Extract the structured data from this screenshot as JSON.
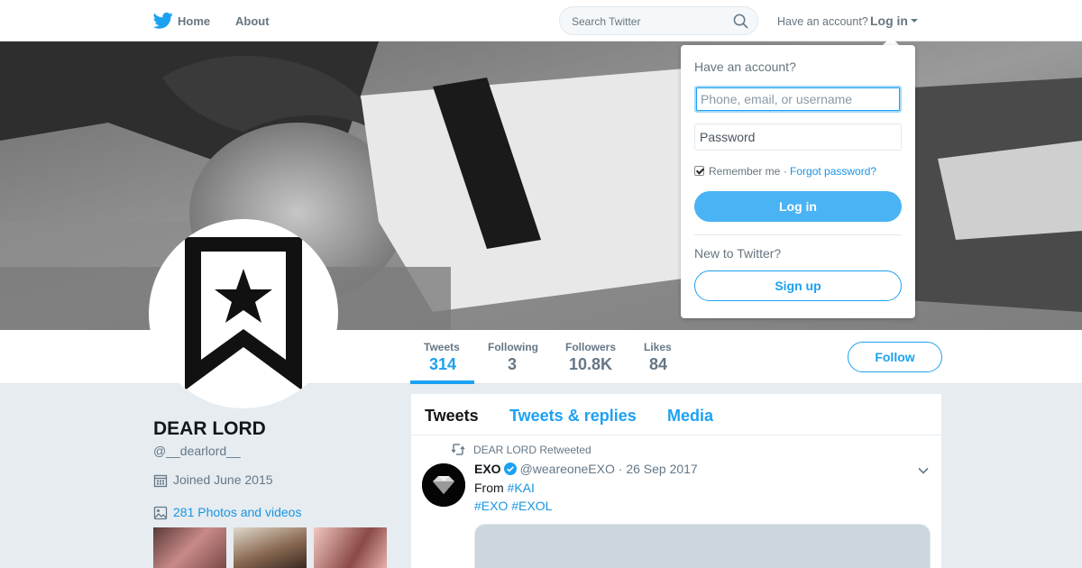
{
  "nav": {
    "home_label": "Home",
    "about_label": "About",
    "search_placeholder": "Search Twitter",
    "have_account": "Have an account?",
    "login_label": "Log in"
  },
  "login_dropdown": {
    "title": "Have an account?",
    "username_placeholder": "Phone, email, or username",
    "password_placeholder": "Password",
    "remember_label": "Remember me",
    "separator": " · ",
    "forgot_label": "Forgot password?",
    "remember_checked": true,
    "login_button": "Log in",
    "new_to_twitter": "New to Twitter?",
    "signup_button": "Sign up"
  },
  "profile_nav": {
    "stats": [
      {
        "label": "Tweets",
        "value": "314",
        "active": true
      },
      {
        "label": "Following",
        "value": "3"
      },
      {
        "label": "Followers",
        "value": "10.8K"
      },
      {
        "label": "Likes",
        "value": "84"
      }
    ],
    "follow_button": "Follow"
  },
  "profile": {
    "name": "DEAR LORD",
    "handle": "@__dearlord__",
    "joined": "Joined June 2015",
    "photos_link": "281 Photos and videos"
  },
  "timeline": {
    "tabs": [
      "Tweets",
      "Tweets & replies",
      "Media"
    ],
    "tweet": {
      "retweet_context": "DEAR LORD Retweeted",
      "author_name": "EXO",
      "author_handle": "@weareoneEXO",
      "separator": " · ",
      "date": "26 Sep 2017",
      "text_prefix": "From ",
      "hashtag_1": "#KAI",
      "hashtags_line": "#EXO #EXOL"
    }
  },
  "colors": {
    "accent": "#1da1f2",
    "link": "#1b95e0",
    "background": "#e6ecf0"
  },
  "icons": [
    "twitter-bird-icon",
    "search-icon",
    "caret-down-icon",
    "calendar-icon",
    "image-icon",
    "retweet-icon",
    "verified-icon",
    "chevron-down-icon",
    "bookmark-star-icon"
  ]
}
